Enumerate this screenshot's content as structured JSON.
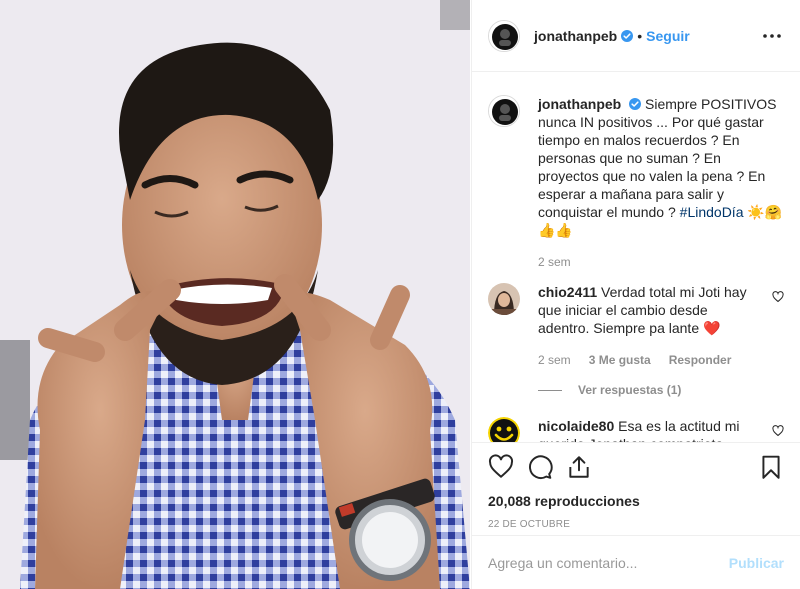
{
  "post": {
    "username": "jonathanpeb",
    "dot": "•",
    "follow_label": "Seguir",
    "more_icon": "more-horizontal-icon",
    "verified_icon": "verified-badge-icon",
    "caption": {
      "username": "jonathanpeb",
      "text": "Siempre POSITIVOS nunca IN positivos ... Por qué gastar tiempo en malos recuerdos ? En personas que no suman ? En proyectos que no valen la pena ? En esperar a mañana para salir y conquistar el mundo ?",
      "hashtag": "#LindoDía",
      "emojis": "☀️🤗👍👍",
      "time": "2 sem"
    },
    "comments": [
      {
        "username": "chio2411",
        "text": "Verdad total mi Joti hay que iniciar el cambio desde adentro. Siempre pa lante ❤️",
        "time": "2 sem",
        "likes": "3 Me gusta",
        "reply_label": "Responder",
        "view_replies": "Ver respuestas (1)"
      },
      {
        "username": "nicolaide80",
        "text": "Esa es la actitud mi querido Jonathan compatriota orgulloso de ti 🤗"
      }
    ],
    "views": "20,088 reproducciones",
    "date": "22 DE OCTUBRE",
    "comment_placeholder": "Agrega un comentario...",
    "publish_label": "Publicar"
  },
  "colors": {
    "link": "#3897f0",
    "text": "#262626",
    "muted": "#8e8e8e",
    "hashtag": "#003569",
    "publish_disabled": "#b2dffc"
  }
}
